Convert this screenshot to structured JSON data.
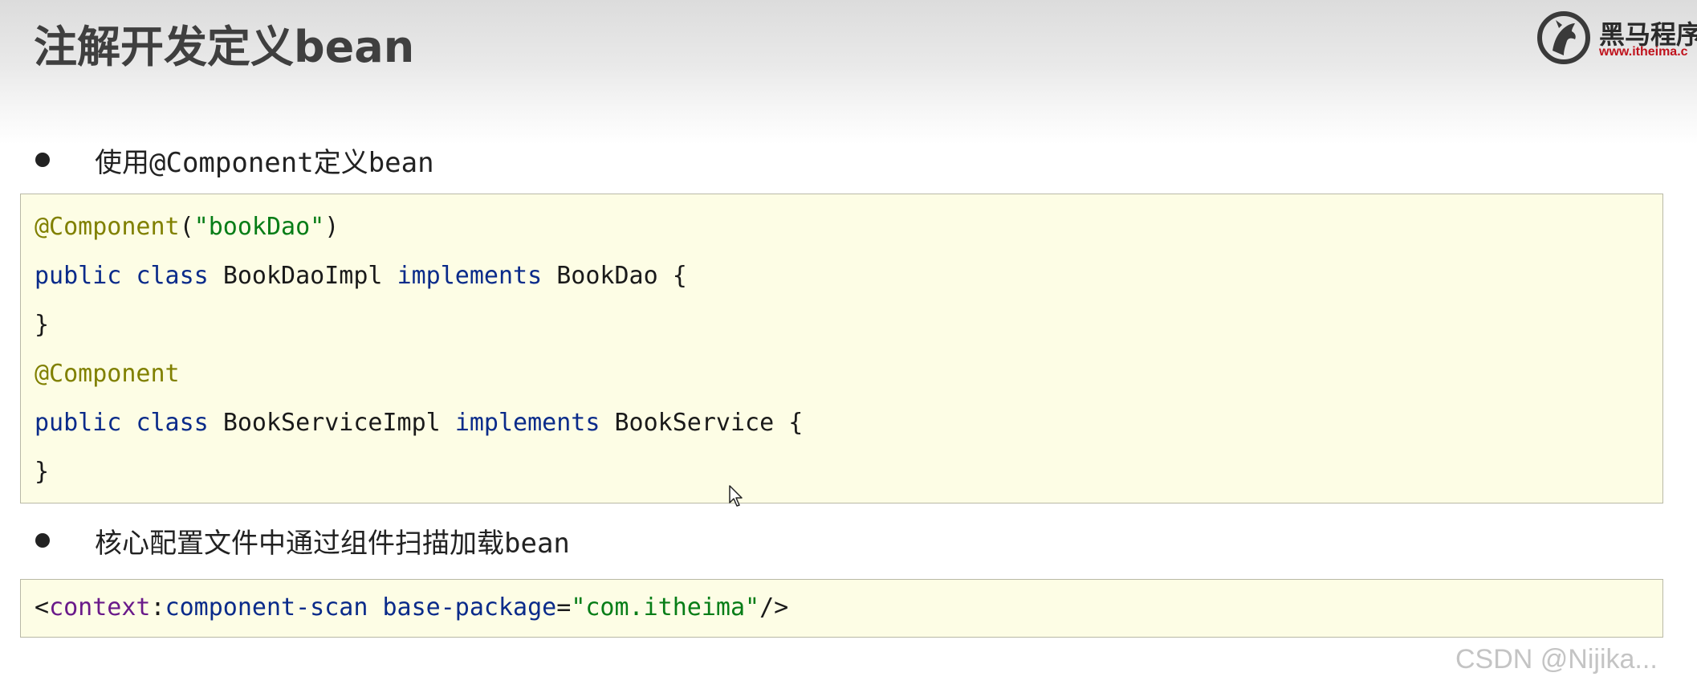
{
  "slide": {
    "title": "注解开发定义bean"
  },
  "logo": {
    "name": "黑马程序",
    "url": "www.itheima.c"
  },
  "section1": {
    "bullet": "使用@Component定义bean",
    "code": {
      "line1": {
        "annotation": "@Component",
        "open": "(",
        "string": "\"bookDao\"",
        "close": ")"
      },
      "line2": {
        "kw_public": "public",
        "kw_class": "class",
        "class_name": "BookDaoImpl",
        "kw_implements": "implements",
        "iface": "BookDao",
        "brace": "{"
      },
      "line3": {
        "brace": "}"
      },
      "line4": {
        "annotation": "@Component"
      },
      "line5": {
        "kw_public": "public",
        "kw_class": "class",
        "class_name": "BookServiceImpl",
        "kw_implements": "implements",
        "iface": "BookService",
        "brace": "{"
      },
      "line6": {
        "brace": "}"
      }
    }
  },
  "section2": {
    "bullet": "核心配置文件中通过组件扫描加载bean",
    "code": {
      "lt": "<",
      "ns": "context",
      "colon": ":",
      "tag": "component-scan",
      "attr": "base-package",
      "eq": "=",
      "value": "\"com.itheima\"",
      "end": "/>"
    }
  },
  "watermark": "CSDN @Nijika...",
  "colors": {
    "code_background": "#fdfde5",
    "code_border": "#b9b9a6",
    "annotation": "#808000",
    "string": "#067d17",
    "keyword": "#0a2b8a",
    "xml_tag": "#6a1a8a",
    "logo_url": "#c0121c"
  },
  "icons": {
    "logo_emblem": "horse-head-icon",
    "cursor": "mouse-pointer-icon",
    "bullet": "bullet-dot-icon"
  }
}
